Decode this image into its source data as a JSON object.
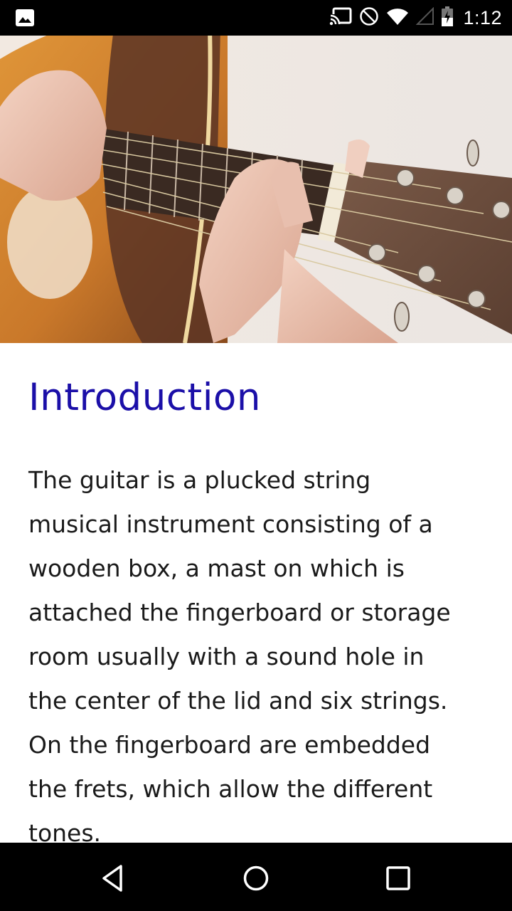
{
  "status_bar": {
    "left_icons": [
      "image-notification-icon"
    ],
    "right_icons": [
      "cast-icon",
      "do-not-disturb-icon",
      "wifi-icon",
      "cell-signal-icon",
      "battery-charging-icon"
    ],
    "time": "1:12"
  },
  "hero": {
    "alt": "Hands playing an acoustic guitar"
  },
  "article": {
    "title": "Introduction",
    "paragraph_lines": [
      "The guitar is a plucked string",
      "musical instrument consisting of a",
      "wooden box, a mast on which is",
      "attached the fingerboard or storage",
      "room usually with a sound hole in",
      "the center of the lid and six strings.",
      "On the fingerboard are embedded",
      "the frets, which allow the different",
      "tones."
    ]
  },
  "nav_bar": {
    "buttons": [
      "back-icon",
      "home-icon",
      "recents-icon"
    ]
  },
  "colors": {
    "title": "#1b0fa8",
    "body_text": "#1a1a1a",
    "system_bars": "#000000"
  }
}
